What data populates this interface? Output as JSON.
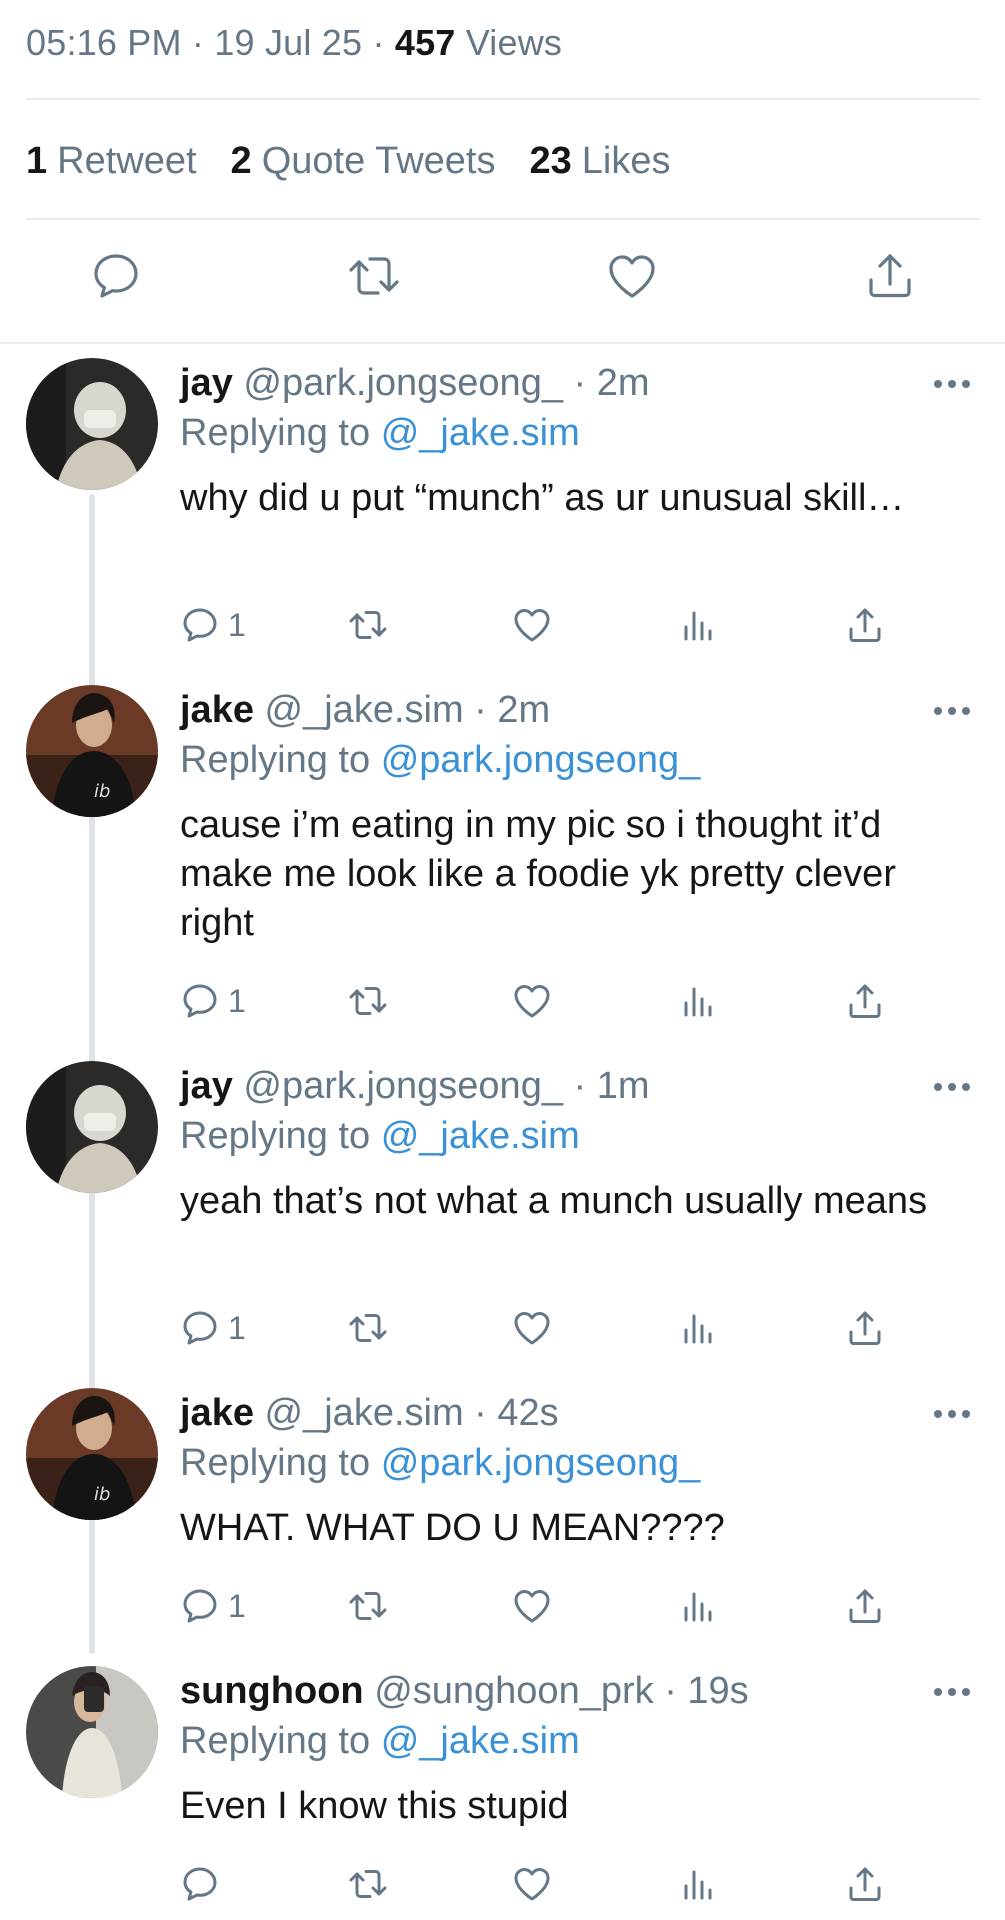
{
  "tweet_meta": {
    "time": "05:16 PM",
    "sep1": "·",
    "date": "19 Jul 25",
    "sep2": "·",
    "views_count": "457",
    "views_label": "Views"
  },
  "stats": {
    "retweets_count": "1",
    "retweets_label": "Retweet",
    "quotes_count": "2",
    "quotes_label": "Quote Tweets",
    "likes_count": "23",
    "likes_label": "Likes"
  },
  "main_actions": [
    "reply-icon",
    "retweet-icon",
    "like-icon",
    "share-icon"
  ],
  "colors": {
    "link": "#3a91d6",
    "muted": "#657786",
    "text": "#14171a",
    "thread_line": "#dfe3e7"
  },
  "replies": [
    {
      "name": "jay",
      "handle": "@park.jongseong_",
      "sep": "·",
      "time": "2m",
      "replying_label": "Replying to",
      "replying_to": "@_jake.sim",
      "text": "why did u put “munch” as ur unusual skill…",
      "reply_count": "1"
    },
    {
      "name": "jake",
      "handle": "@_jake.sim",
      "sep": "·",
      "time": "2m",
      "replying_label": "Replying to",
      "replying_to": "@park.jongseong_",
      "text": "cause i’m eating in my pic so i thought it’d make me look like a foodie yk pretty clever right",
      "reply_count": "1"
    },
    {
      "name": "jay",
      "handle": "@park.jongseong_",
      "sep": "·",
      "time": "1m",
      "replying_label": "Replying to",
      "replying_to": "@_jake.sim",
      "text": "yeah that’s not what a munch usually means",
      "reply_count": "1"
    },
    {
      "name": "jake",
      "handle": "@_jake.sim",
      "sep": "·",
      "time": "42s",
      "replying_label": "Replying to",
      "replying_to": "@park.jongseong_",
      "text": "WHAT. WHAT DO U MEAN????",
      "reply_count": "1"
    },
    {
      "name": "sunghoon",
      "handle": "@sunghoon_prk",
      "sep": "·",
      "time": "19s",
      "replying_label": "Replying to",
      "replying_to": "@_jake.sim",
      "text": "Even I know this stupid",
      "reply_count": ""
    }
  ]
}
